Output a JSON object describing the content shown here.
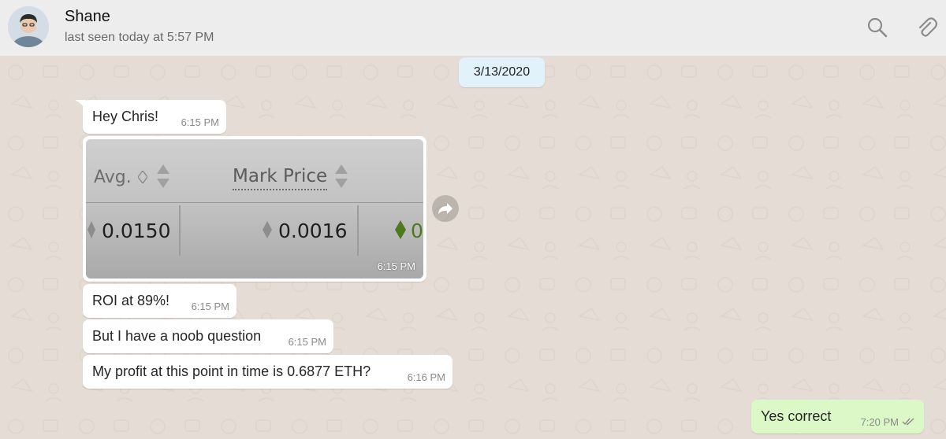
{
  "header": {
    "contact_name": "Shane",
    "last_seen": "last seen today at 5:57 PM",
    "icons": [
      "search-icon",
      "attach-icon"
    ]
  },
  "chat": {
    "date_chip": "3/13/2020",
    "messages": [
      {
        "text": "Hey Chris!",
        "time": "6:15 PM",
        "direction": "incoming"
      },
      {
        "type": "image",
        "time": "6:15 PM",
        "direction": "incoming",
        "image_text": {
          "col1_header": "Avg.",
          "col2_header": "Mark Price",
          "col1_value": "0.0150",
          "col2_value": "0.0016",
          "col3_value": "0"
        }
      },
      {
        "text": "ROI at 89%!",
        "time": "6:15 PM",
        "direction": "incoming"
      },
      {
        "text": "But I have a noob question",
        "time": "6:15 PM",
        "direction": "incoming"
      },
      {
        "text": "My profit at this point in time is 0.6877 ETH?",
        "time": "6:16 PM",
        "direction": "incoming"
      },
      {
        "text": "Yes correct",
        "time": "7:20 PM",
        "direction": "outgoing",
        "status": "read-double-check"
      }
    ]
  },
  "colors": {
    "header_bg": "#ededed",
    "chat_bg": "#e5ddd5",
    "incoming_bubble": "#ffffff",
    "outgoing_bubble": "#dcf8c6",
    "date_chip": "#e1f2fb",
    "read_check": "#8a8a8a"
  }
}
